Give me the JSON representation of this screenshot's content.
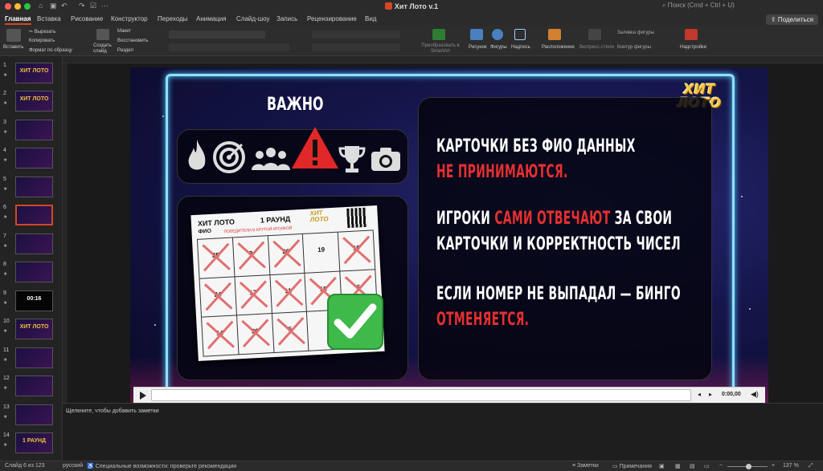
{
  "window": {
    "title": "Хит Лото v.1",
    "search_placeholder": "Поиск (Cmd + Ctrl + U)",
    "share": "Поделиться"
  },
  "tabs": [
    "Главная",
    "Вставка",
    "Рисование",
    "Конструктор",
    "Переходы",
    "Анимация",
    "Слайд-шоу",
    "Запись",
    "Рецензирование",
    "Вид"
  ],
  "ribbon": {
    "paste": "Вставить",
    "cut": "Вырезать",
    "copy": "Копировать",
    "format_painter": "Формат по образцу",
    "new_slide": "Создать слайд",
    "layout": "Макет",
    "reset": "Восстановить",
    "section": "Раздел",
    "smartart": "Преобразовать в SmartArt",
    "picture": "Рисунок",
    "shapes": "Фигуры",
    "textbox": "Надпись",
    "arrange": "Расположение",
    "quick_styles": "Экспресс-стили",
    "shape_fill": "Заливка фигуры",
    "shape_outline": "Контур фигуры",
    "addins": "Надстройки"
  },
  "thumbnails": [
    {
      "num": "1",
      "label": "ХИТ ЛОТО"
    },
    {
      "num": "2",
      "label": "ХИТ ЛОТО"
    },
    {
      "num": "3",
      "label": ""
    },
    {
      "num": "4",
      "label": ""
    },
    {
      "num": "5",
      "label": ""
    },
    {
      "num": "6",
      "label": ""
    },
    {
      "num": "7",
      "label": ""
    },
    {
      "num": "8",
      "label": ""
    },
    {
      "num": "9",
      "label": "00:16"
    },
    {
      "num": "10",
      "label": "ХИТ ЛОТО"
    },
    {
      "num": "11",
      "label": ""
    },
    {
      "num": "12",
      "label": ""
    },
    {
      "num": "13",
      "label": ""
    },
    {
      "num": "14",
      "label": "1 РАУНД"
    }
  ],
  "slide": {
    "logo_line1": "ХИТ",
    "logo_line2": "ЛОТО",
    "heading": "ВАЖНО",
    "card": {
      "title": "ХИТ ЛОТО",
      "fio": "ФИО",
      "round": "1 РАУНД",
      "subtitle": "ПОБЕДИТЕЛИ В КРУТОЙ ИГОЛКОЙ",
      "logo": "ХИТ ЛОТО",
      "cells": [
        "25",
        "3",
        "20",
        "19",
        "10",
        "24",
        "17",
        "11",
        "15",
        "6",
        "14",
        "30",
        "5",
        "",
        ""
      ]
    },
    "lines": [
      {
        "a": "КАРТОЧКИ БЕЗ ФИО ДАННЫХ",
        "b": "",
        "c": ""
      },
      {
        "a": "",
        "b": "НЕ ПРИНИМАЮТСЯ.",
        "c": ""
      },
      {
        "a": "ИГРОКИ ",
        "b": "САМИ ОТВЕЧАЮТ",
        "c": " ЗА СВОИ"
      },
      {
        "a": "КАРТОЧКИ И КОРРЕКТНОСТЬ ЧИСЕЛ",
        "b": "",
        "c": ""
      },
      {
        "a": "ЕСЛИ НОМЕР НЕ ВЫПАДАЛ — БИНГО",
        "b": "",
        "c": ""
      },
      {
        "a": "",
        "b": "ОТМЕНЯЕТСЯ.",
        "c": ""
      }
    ]
  },
  "player": {
    "time": "0:00,00"
  },
  "notes_placeholder": "Щелкните, чтобы добавить заметки",
  "status": {
    "slide_of": "Слайд 6 из 123",
    "language": "русский",
    "accessibility": "Специальные возможности: проверьте рекомендации",
    "notes": "Заметки",
    "comments": "Примечания",
    "zoom": "137 %"
  },
  "colors": {
    "accent": "#d24726",
    "slide_red": "#e53030",
    "neon": "#8fe0ff",
    "gold": "#f3c548"
  }
}
